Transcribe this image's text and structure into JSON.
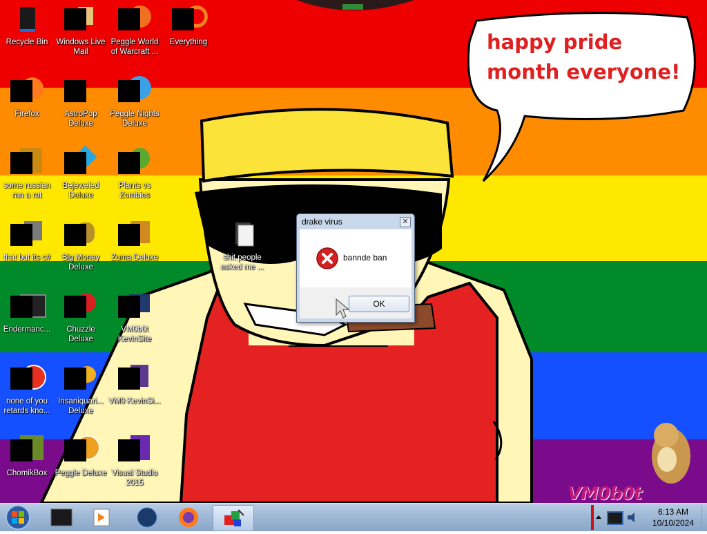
{
  "desktop": {
    "stripes": [
      "#ff0000",
      "#ff8c00",
      "#ffed00",
      "#008026",
      "#004dff",
      "#750787"
    ],
    "speech_bubble": "happy pride month everyone!",
    "watermark": "VM0b0t",
    "icons": [
      {
        "label": "Recycle Bin",
        "icon": "recycle-bin-icon"
      },
      {
        "label": "Windows Live Mail",
        "icon": "mail-icon"
      },
      {
        "label": "Peggle World of Warcraft ...",
        "icon": "peggle-icon"
      },
      {
        "label": "Everything",
        "icon": "search-icon"
      },
      {
        "label": "Firefox",
        "icon": "firefox-icon"
      },
      {
        "label": "AstroPop Deluxe",
        "icon": "game-icon"
      },
      {
        "label": "Peggle Nights Deluxe",
        "icon": "peggle-icon"
      },
      {
        "label": "some russian ran a rat",
        "icon": "app-icon"
      },
      {
        "label": "Bejeweled Deluxe",
        "icon": "gem-icon"
      },
      {
        "label": "Plants vs Zombies",
        "icon": "plant-icon"
      },
      {
        "label": "that but its c#",
        "icon": "app-icon"
      },
      {
        "label": "Big Money Deluxe",
        "icon": "money-bag-icon"
      },
      {
        "label": "Zuma Deluxe",
        "icon": "zuma-icon"
      },
      {
        "label": "Endermanc...",
        "icon": "terminal-icon"
      },
      {
        "label": "Chuzzle Deluxe",
        "icon": "chuzzle-icon"
      },
      {
        "label": "VM0b0t KevinSite",
        "icon": "website-icon"
      },
      {
        "label": "none of you retards kno...",
        "icon": "chrome-icon"
      },
      {
        "label": "Insaniquari... Deluxe",
        "icon": "fish-icon"
      },
      {
        "label": "VM0 KevinSi...",
        "icon": "file-icon"
      },
      {
        "label": "ChomikBox",
        "icon": "hamster-icon"
      },
      {
        "label": "Peggle Deluxe",
        "icon": "peggle-icon"
      },
      {
        "label": "Visual Studio 2015",
        "icon": "visual-studio-icon"
      }
    ],
    "folder_icon": {
      "label": "shit people asked me ...",
      "icon": "folder-icon"
    }
  },
  "dialog": {
    "title": "drake virus",
    "message": "bannde ban",
    "ok_label": "OK",
    "close_glyph": "✕"
  },
  "taskbar": {
    "start": "start-orb-icon",
    "pinned": [
      "cmd-icon",
      "media-player-icon",
      "network-globe-icon",
      "firefox-icon",
      "paint-app-icon"
    ],
    "clock_time": "6:13 AM",
    "clock_date": "10/10/2024"
  }
}
